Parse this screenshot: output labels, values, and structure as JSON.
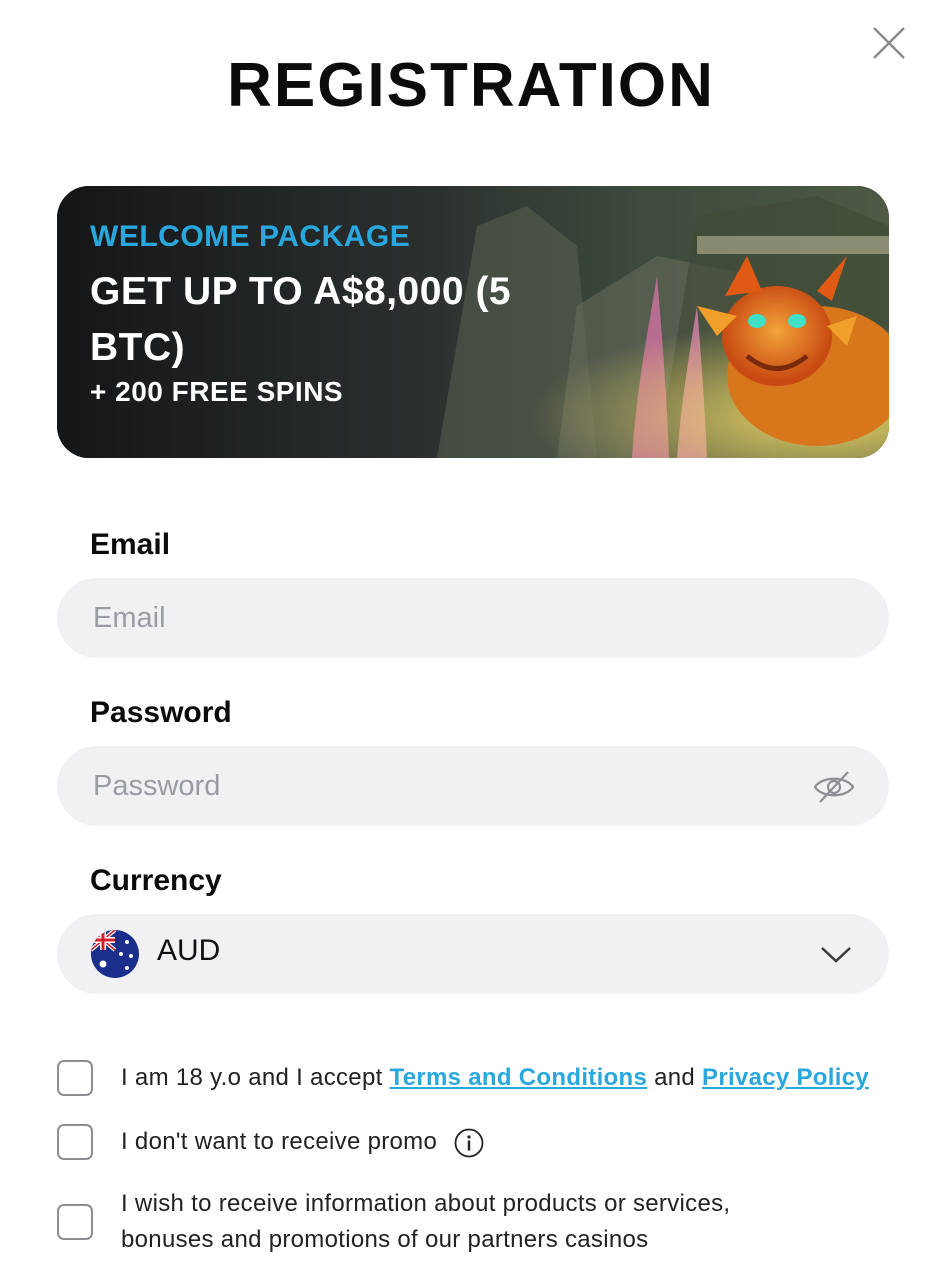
{
  "modal": {
    "title": "REGISTRATION",
    "close_icon": "close-icon"
  },
  "banner": {
    "welcome_label": "WELCOME PACKAGE",
    "headline": "GET UP TO A$8,000 (5 BTC)",
    "spins": "+ 200 FREE SPINS",
    "accent_color": "#2aa8de",
    "artwork": "dragon-illustration"
  },
  "form": {
    "email": {
      "label": "Email",
      "placeholder": "Email",
      "value": ""
    },
    "password": {
      "label": "Password",
      "placeholder": "Password",
      "value": "",
      "toggle_icon": "eye-slash-icon"
    },
    "currency": {
      "label": "Currency",
      "selected": "AUD",
      "flag_icon": "australia-flag-icon",
      "dropdown_icon": "chevron-down-icon"
    }
  },
  "checkboxes": {
    "age": {
      "prefix": "I am 18 y.o and I accept",
      "terms_link": "Terms and Conditions",
      "conjunction": "and",
      "privacy_link": "Privacy Policy",
      "checked": false
    },
    "promo": {
      "text": "I don't want to receive promo",
      "info_icon": "info-icon",
      "checked": false
    },
    "partners": {
      "line1": "I wish to receive information about products or services,",
      "line2": "bonuses and promotions of our partners casinos",
      "checked": false
    }
  }
}
